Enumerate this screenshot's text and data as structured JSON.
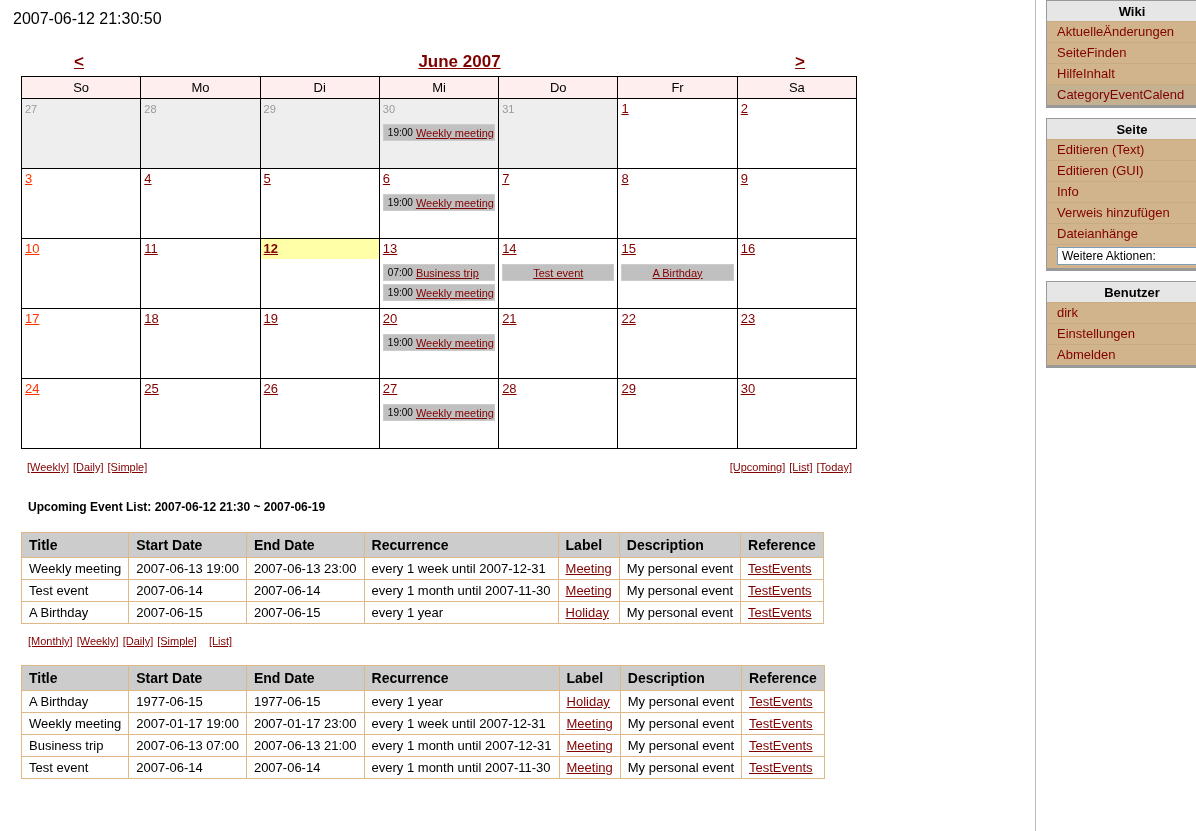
{
  "timestamp": "2007-06-12 21:30:50",
  "calendar": {
    "prev": "<",
    "title": "June 2007",
    "next": ">",
    "weekdays": [
      "So",
      "Mo",
      "Di",
      "Mi",
      "Do",
      "Fr",
      "Sa"
    ],
    "weeks": [
      [
        {
          "day": "27",
          "outside": true,
          "today": false
        },
        {
          "day": "28",
          "outside": true,
          "today": false
        },
        {
          "day": "29",
          "outside": true,
          "today": false
        },
        {
          "day": "30",
          "outside": true,
          "today": false,
          "events": [
            {
              "time": "19:00",
              "title": "Weekly meeting"
            }
          ]
        },
        {
          "day": "31",
          "outside": true,
          "today": false
        },
        {
          "day": "1",
          "outside": false,
          "today": false
        },
        {
          "day": "2",
          "outside": false,
          "today": false
        }
      ],
      [
        {
          "day": "3",
          "outside": false,
          "today": false
        },
        {
          "day": "4",
          "outside": false,
          "today": false
        },
        {
          "day": "5",
          "outside": false,
          "today": false
        },
        {
          "day": "6",
          "outside": false,
          "today": false,
          "events": [
            {
              "time": "19:00",
              "title": "Weekly meeting"
            }
          ]
        },
        {
          "day": "7",
          "outside": false,
          "today": false
        },
        {
          "day": "8",
          "outside": false,
          "today": false
        },
        {
          "day": "9",
          "outside": false,
          "today": false
        }
      ],
      [
        {
          "day": "10",
          "outside": false,
          "today": false
        },
        {
          "day": "11",
          "outside": false,
          "today": false
        },
        {
          "day": "12",
          "outside": false,
          "today": true
        },
        {
          "day": "13",
          "outside": false,
          "today": false,
          "events": [
            {
              "time": "07:00",
              "title": "Business trip"
            },
            {
              "time": "19:00",
              "title": "Weekly meeting"
            }
          ]
        },
        {
          "day": "14",
          "outside": false,
          "today": false,
          "events": [
            {
              "title": "Test event"
            }
          ]
        },
        {
          "day": "15",
          "outside": false,
          "today": false,
          "events": [
            {
              "title": "A Birthday"
            }
          ]
        },
        {
          "day": "16",
          "outside": false,
          "today": false
        }
      ],
      [
        {
          "day": "17",
          "outside": false,
          "today": false
        },
        {
          "day": "18",
          "outside": false,
          "today": false
        },
        {
          "day": "19",
          "outside": false,
          "today": false
        },
        {
          "day": "20",
          "outside": false,
          "today": false,
          "events": [
            {
              "time": "19:00",
              "title": "Weekly meeting"
            }
          ]
        },
        {
          "day": "21",
          "outside": false,
          "today": false
        },
        {
          "day": "22",
          "outside": false,
          "today": false
        },
        {
          "day": "23",
          "outside": false,
          "today": false
        }
      ],
      [
        {
          "day": "24",
          "outside": false,
          "today": false
        },
        {
          "day": "25",
          "outside": false,
          "today": false
        },
        {
          "day": "26",
          "outside": false,
          "today": false
        },
        {
          "day": "27",
          "outside": false,
          "today": false,
          "events": [
            {
              "time": "19:00",
              "title": "Weekly meeting"
            }
          ]
        },
        {
          "day": "28",
          "outside": false,
          "today": false
        },
        {
          "day": "29",
          "outside": false,
          "today": false
        },
        {
          "day": "30",
          "outside": false,
          "today": false
        }
      ]
    ]
  },
  "view_links_left": [
    "[Weekly]",
    "[Daily]",
    "[Simple]"
  ],
  "view_links_right": [
    "[Upcoming]",
    "[List]",
    "[Today]"
  ],
  "upcoming": {
    "heading": "Upcoming Event List: 2007-06-12 21:30 ~ 2007-06-19",
    "columns": [
      {
        "label": "Title",
        "kind": "text"
      },
      {
        "label": "Start Date",
        "kind": "text"
      },
      {
        "label": "End Date",
        "kind": "text"
      },
      {
        "label": "Recurrence",
        "kind": "text"
      },
      {
        "label": "Label",
        "kind": "link"
      },
      {
        "label": "Description",
        "kind": "text"
      },
      {
        "label": "Reference",
        "kind": "link"
      }
    ],
    "rows": [
      [
        "Weekly meeting",
        "2007-06-13 19:00",
        "2007-06-13 23:00",
        "every 1 week until 2007-12-31",
        "Meeting",
        "My personal event",
        "TestEvents"
      ],
      [
        "Test event",
        "2007-06-14",
        "2007-06-14",
        "every 1 month until 2007-11-30",
        "Meeting",
        "My personal event",
        "TestEvents"
      ],
      [
        "A Birthday",
        "2007-06-15",
        "2007-06-15",
        "every 1 year",
        "Holiday",
        "My personal event",
        "TestEvents"
      ]
    ]
  },
  "list_links": [
    "[Monthly]",
    "[Weekly]",
    "[Daily]",
    "[Simple]",
    "[List]"
  ],
  "event_list": {
    "columns": [
      {
        "label": "Title",
        "kind": "text"
      },
      {
        "label": "Start Date",
        "kind": "text"
      },
      {
        "label": "End Date",
        "kind": "text"
      },
      {
        "label": "Recurrence",
        "kind": "text"
      },
      {
        "label": "Label",
        "kind": "link"
      },
      {
        "label": "Description",
        "kind": "text"
      },
      {
        "label": "Reference",
        "kind": "link"
      }
    ],
    "rows": [
      [
        "A Birthday",
        "1977-06-15",
        "1977-06-15",
        "every 1 year",
        "Holiday",
        "My personal event",
        "TestEvents"
      ],
      [
        "Weekly meeting",
        "2007-01-17 19:00",
        "2007-01-17 23:00",
        "every 1 week until 2007-12-31",
        "Meeting",
        "My personal event",
        "TestEvents"
      ],
      [
        "Business trip",
        "2007-06-13 07:00",
        "2007-06-13 21:00",
        "every 1 month until 2007-12-31",
        "Meeting",
        "My personal event",
        "TestEvents"
      ],
      [
        "Test event",
        "2007-06-14",
        "2007-06-14",
        "every 1 month until 2007-11-30",
        "Meeting",
        "My personal event",
        "TestEvents"
      ]
    ]
  },
  "sidebar": [
    {
      "title": "Wiki",
      "items": [
        {
          "kind": "link",
          "label": "AktuelleÄnderungen",
          "selected": false
        },
        {
          "kind": "link",
          "label": "SeiteFinden",
          "selected": false
        },
        {
          "kind": "link",
          "label": "HilfeInhalt",
          "selected": false
        },
        {
          "kind": "link",
          "label": "CategoryEventCalend",
          "selected": true
        }
      ]
    },
    {
      "title": "Seite",
      "items": [
        {
          "kind": "link",
          "label": "Editieren (Text)"
        },
        {
          "kind": "link",
          "label": "Editieren (GUI)"
        },
        {
          "kind": "link",
          "label": "Info"
        },
        {
          "kind": "link",
          "label": "Verweis hinzufügen"
        },
        {
          "kind": "link",
          "label": "Dateianhänge"
        },
        {
          "kind": "select",
          "label": "Weitere Aktionen:"
        }
      ]
    },
    {
      "title": "Benutzer",
      "items": [
        {
          "kind": "link",
          "label": "dirk"
        },
        {
          "kind": "link",
          "label": "Einstellungen"
        },
        {
          "kind": "link",
          "label": "Abmelden"
        }
      ]
    }
  ]
}
